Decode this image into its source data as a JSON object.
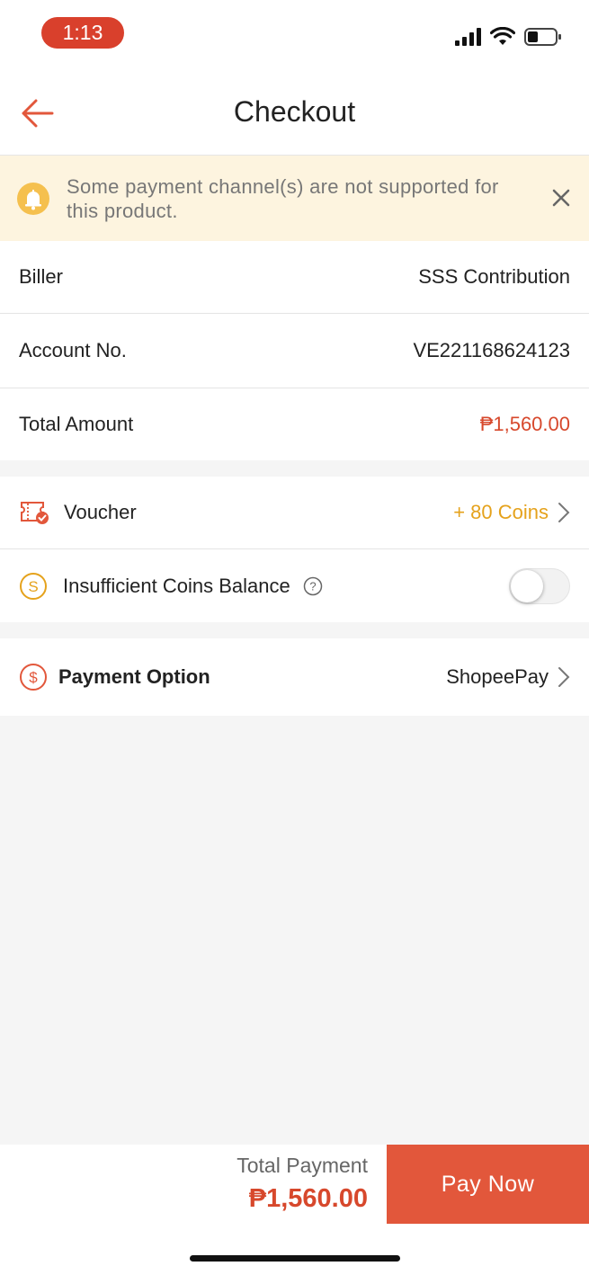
{
  "status_bar": {
    "time": "1:13",
    "battery_level": 0.35
  },
  "header": {
    "title": "Checkout"
  },
  "notice": {
    "text": "Some payment channel(s) are not supported for this product."
  },
  "details": {
    "biller_label": "Biller",
    "biller_value": "SSS Contribution",
    "account_label": "Account No.",
    "account_value": "VE221168624123",
    "total_label": "Total Amount",
    "total_value": "₱1,560.00"
  },
  "voucher": {
    "label": "Voucher",
    "value": "+ 80 Coins"
  },
  "coins": {
    "label": "Insufficient Coins Balance",
    "toggle_on": false
  },
  "payment": {
    "label": "Payment Option",
    "value": "ShopeePay"
  },
  "footer": {
    "total_label": "Total Payment",
    "total_value": "₱1,560.00",
    "pay_button": "Pay Now"
  },
  "colors": {
    "accent": "#e2573b",
    "price": "#d7482c",
    "coins": "#e5a21c",
    "notice_bg": "#fdf4df"
  }
}
